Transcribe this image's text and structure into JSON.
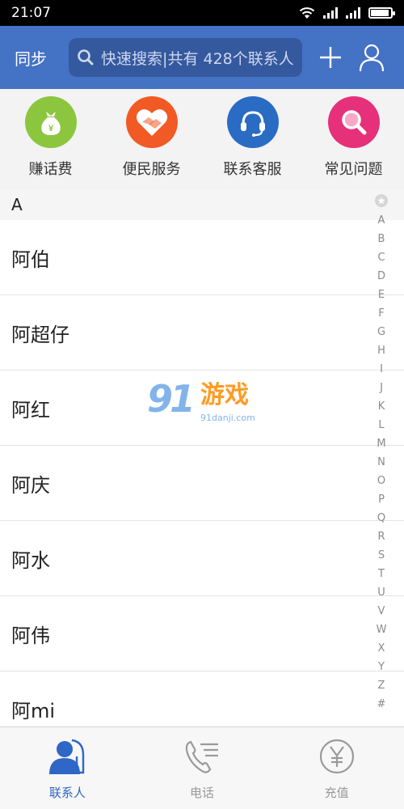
{
  "status_bar": {
    "time": "21:07"
  },
  "header": {
    "sync_label": "同步",
    "search_placeholder": "快速搜索|共有 428个联系人",
    "add_icon": "plus-icon",
    "profile_icon": "user-icon"
  },
  "quick_actions": [
    {
      "label": "赚话费",
      "icon": "money-bag-icon",
      "color": "#8cc63f"
    },
    {
      "label": "便民服务",
      "icon": "handshake-heart-icon",
      "color": "#f15a24"
    },
    {
      "label": "联系客服",
      "icon": "headset-icon",
      "color": "#2a6bc4"
    },
    {
      "label": "常见问题",
      "icon": "magnifier-icon",
      "color": "#e6307a"
    }
  ],
  "contacts": {
    "section": "A",
    "items": [
      "阿伯",
      "阿超仔",
      "阿红",
      "阿庆",
      "阿水",
      "阿伟",
      "阿mi"
    ]
  },
  "alpha_index": [
    "A",
    "B",
    "C",
    "D",
    "E",
    "F",
    "G",
    "H",
    "I",
    "J",
    "K",
    "L",
    "M",
    "N",
    "O",
    "P",
    "Q",
    "R",
    "S",
    "T",
    "U",
    "V",
    "W",
    "X",
    "Y",
    "Z",
    "#"
  ],
  "watermark": {
    "main": "91",
    "text": "游戏",
    "sub": "91danji.com"
  },
  "tabs": [
    {
      "label": "联系人",
      "icon": "contacts-icon",
      "active": true
    },
    {
      "label": "电话",
      "icon": "phone-icon",
      "active": false
    },
    {
      "label": "充值",
      "icon": "yuan-icon",
      "active": false
    }
  ],
  "colors": {
    "header": "#4472c4",
    "search_bg": "#35599f",
    "active_tab": "#2f67c6"
  }
}
